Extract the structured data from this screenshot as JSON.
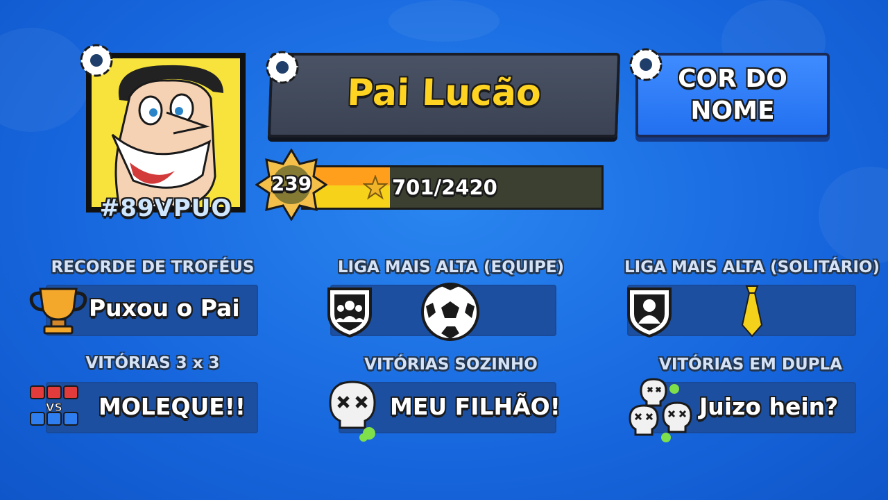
{
  "profile": {
    "name": "Pai Lucão",
    "tag": "#89VPUO",
    "name_color_button": "COR DO NOME",
    "level": "239",
    "xp_text": "701/2420",
    "xp_progress": 0.2897
  },
  "stats": {
    "trophy_record": {
      "label": "RECORDE DE TROFÉUS",
      "value": "Puxou o Pai"
    },
    "league_team": {
      "label": "LIGA MAIS ALTA (EQUIPE)"
    },
    "league_solo": {
      "label": "LIGA MAIS ALTA (SOLITÁRIO)"
    },
    "wins_3v3": {
      "label": "VITÓRIAS 3 x 3",
      "value": "MOLEQUE!!"
    },
    "wins_solo": {
      "label": "VITÓRIAS SOZINHO",
      "value": "MEU FILHÃO!"
    },
    "wins_duo": {
      "label": "VITÓRIAS EM DUPLA",
      "value": "Juizo hein?"
    }
  },
  "icons": {
    "settings": "gear-icon",
    "trophy": "trophy-icon",
    "team_league": "team-shield-icon",
    "solo_league": "solo-shield-icon",
    "team_league_item": "soccer-ball-icon",
    "solo_league_item": "tie-icon",
    "versus": "vs-icon",
    "skull": "skull-icon",
    "skulls": "skulls-icon"
  },
  "colors": {
    "background": "#1766dd",
    "name_text": "#ffd321",
    "name_button": "#2f7ef5",
    "xp_fill": "#f7d21a",
    "tag_text": "#cfe6ff"
  }
}
